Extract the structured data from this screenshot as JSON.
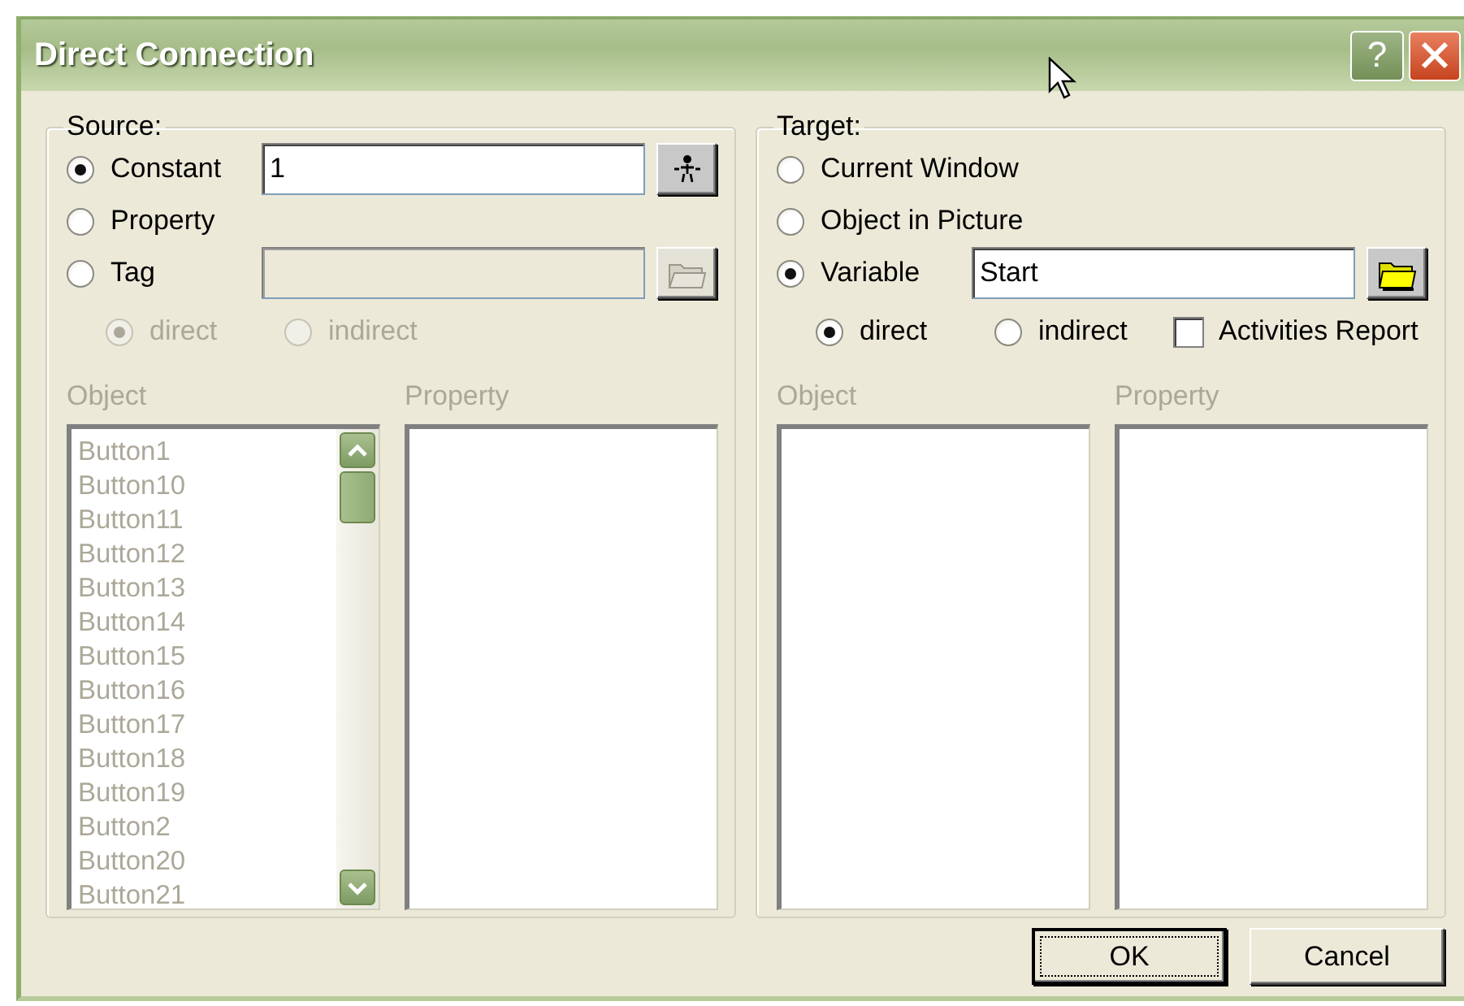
{
  "window": {
    "title": "Direct Connection",
    "help_button": "?"
  },
  "source": {
    "label": "Source:",
    "options": [
      {
        "label": "Constant",
        "selected": true,
        "field": {
          "value": "1",
          "disabled": false
        },
        "button": {
          "kind": "person"
        }
      },
      {
        "label": "Property",
        "selected": false
      },
      {
        "label": "Tag",
        "selected": false,
        "field": {
          "disabled": true
        },
        "button": {
          "kind": "folder"
        }
      }
    ],
    "mode": {
      "disabled": true,
      "options": [
        {
          "label": "direct",
          "selected": true
        },
        {
          "label": "indirect",
          "selected": false
        }
      ]
    },
    "object_list": {
      "label": "Object",
      "disabled": true,
      "items": [
        "Button1",
        "Button10",
        "Button11",
        "Button12",
        "Button13",
        "Button14",
        "Button15",
        "Button16",
        "Button17",
        "Button18",
        "Button19",
        "Button2",
        "Button20",
        "Button21"
      ]
    },
    "property_list": {
      "label": "Property",
      "disabled": true
    }
  },
  "target": {
    "label": "Target:",
    "options": [
      {
        "label": "Current Window",
        "selected": false
      },
      {
        "label": "Object in Picture",
        "selected": false
      },
      {
        "label": "Variable",
        "selected": true,
        "field": {
          "value": "Start",
          "disabled": false
        },
        "button": {
          "kind": "folder"
        }
      }
    ],
    "mode": {
      "disabled": false,
      "options": [
        {
          "label": "direct",
          "selected": true
        },
        {
          "label": "indirect",
          "selected": false
        }
      ],
      "checkbox": {
        "label": "Activities Report",
        "checked": false
      }
    },
    "object_list": {
      "label": "Object",
      "disabled": true
    },
    "property_list": {
      "label": "Property",
      "disabled": true
    }
  },
  "buttons": [
    {
      "label": "OK",
      "focused": true
    },
    {
      "label": "Cancel",
      "focused": false
    }
  ]
}
